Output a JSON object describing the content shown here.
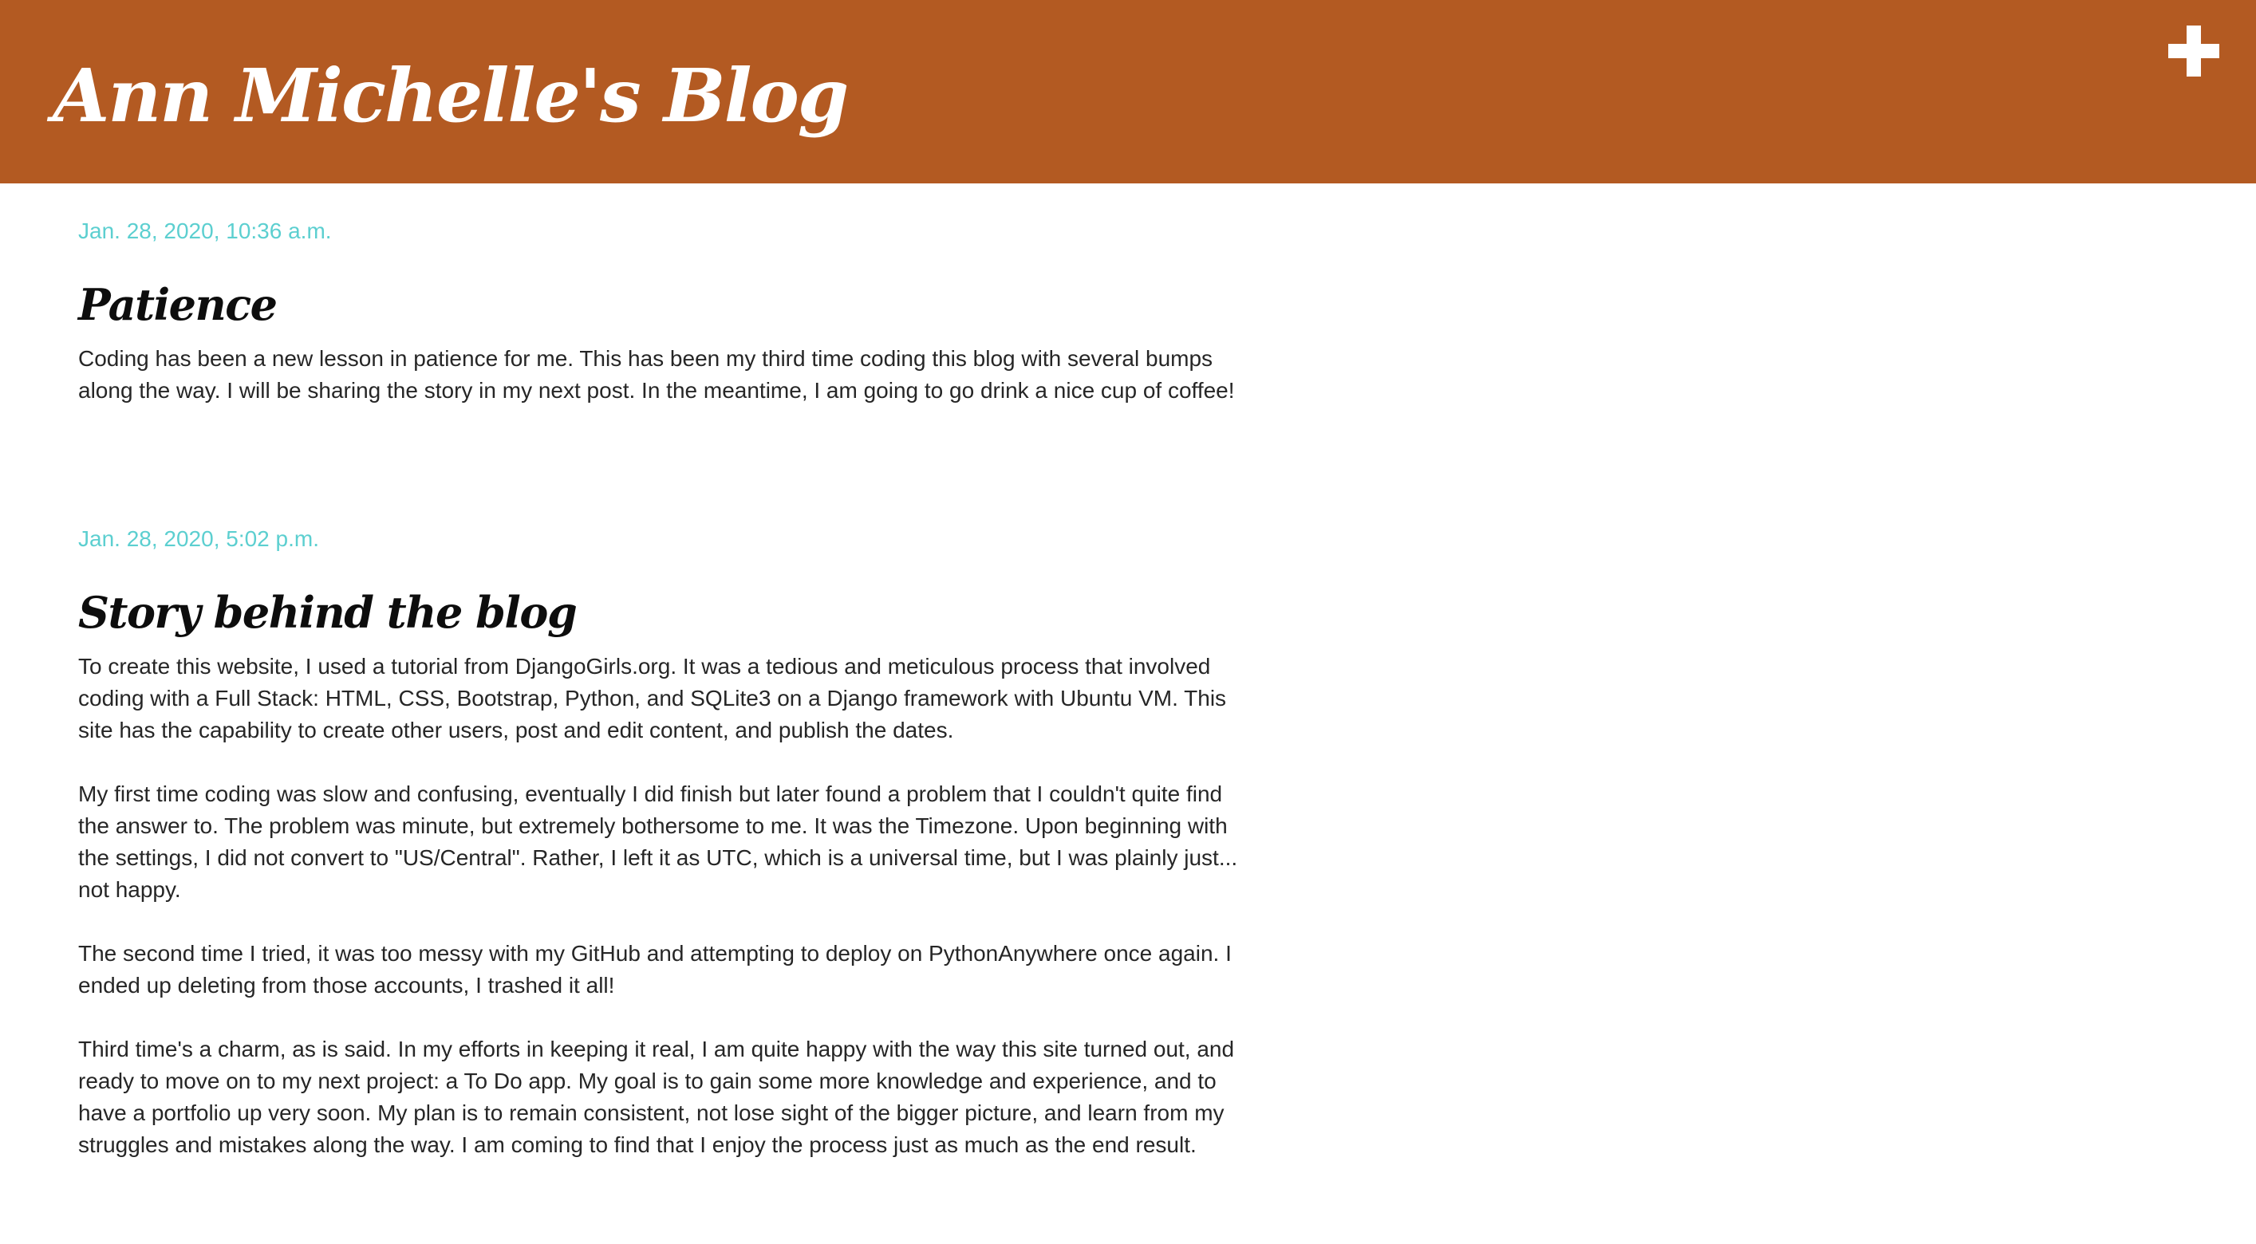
{
  "header": {
    "title": "Ann Michelle's Blog",
    "add_icon": "plus-icon",
    "background_color": "#b35a22"
  },
  "colors": {
    "date": "#5ccfd0",
    "title": "#0d0d0d",
    "body": "#262626"
  },
  "posts": [
    {
      "date": "Jan. 28, 2020, 10:36 a.m.",
      "title": "Patience",
      "paragraphs": [
        "Coding has been a new lesson in patience for me. This has been my third time coding this blog with several bumps\nalong the way. I will be sharing the story in my next post. In the meantime, I am going to go drink a nice cup of coffee!"
      ]
    },
    {
      "date": "Jan. 28, 2020, 5:02 p.m.",
      "title": "Story behind the blog",
      "paragraphs": [
        "To create this website, I used a tutorial from DjangoGirls.org. It was a tedious and meticulous process that involved\ncoding with a Full Stack: HTML, CSS, Bootstrap, Python, and SQLite3 on a Django framework with Ubuntu VM. This\nsite has the capability to create other users, post and edit content, and publish the dates.",
        "My first time coding was slow and confusing, eventually I did finish but later found a problem that I couldn't quite find\nthe answer to. The problem was minute, but extremely bothersome to me. It was the Timezone. Upon beginning with\nthe settings, I did not convert to \"US/Central\". Rather, I left it as UTC, which is a universal time, but I was plainly just...\nnot happy.",
        "The second time I tried, it was too messy with my GitHub and attempting to deploy on PythonAnywhere once again. I\nended up deleting from those accounts, I trashed it all!",
        "Third time's a charm, as is said. In my efforts in keeping it real, I am quite happy with the way this site turned out, and\nready to move on to my next project: a To Do app. My goal is to gain some more knowledge and experience, and to\nhave a portfolio up very soon. My plan is to remain consistent, not lose sight of the bigger picture, and learn from my\nstruggles and mistakes along the way. I am coming to find that I enjoy the process just as much as the end result."
      ]
    }
  ]
}
